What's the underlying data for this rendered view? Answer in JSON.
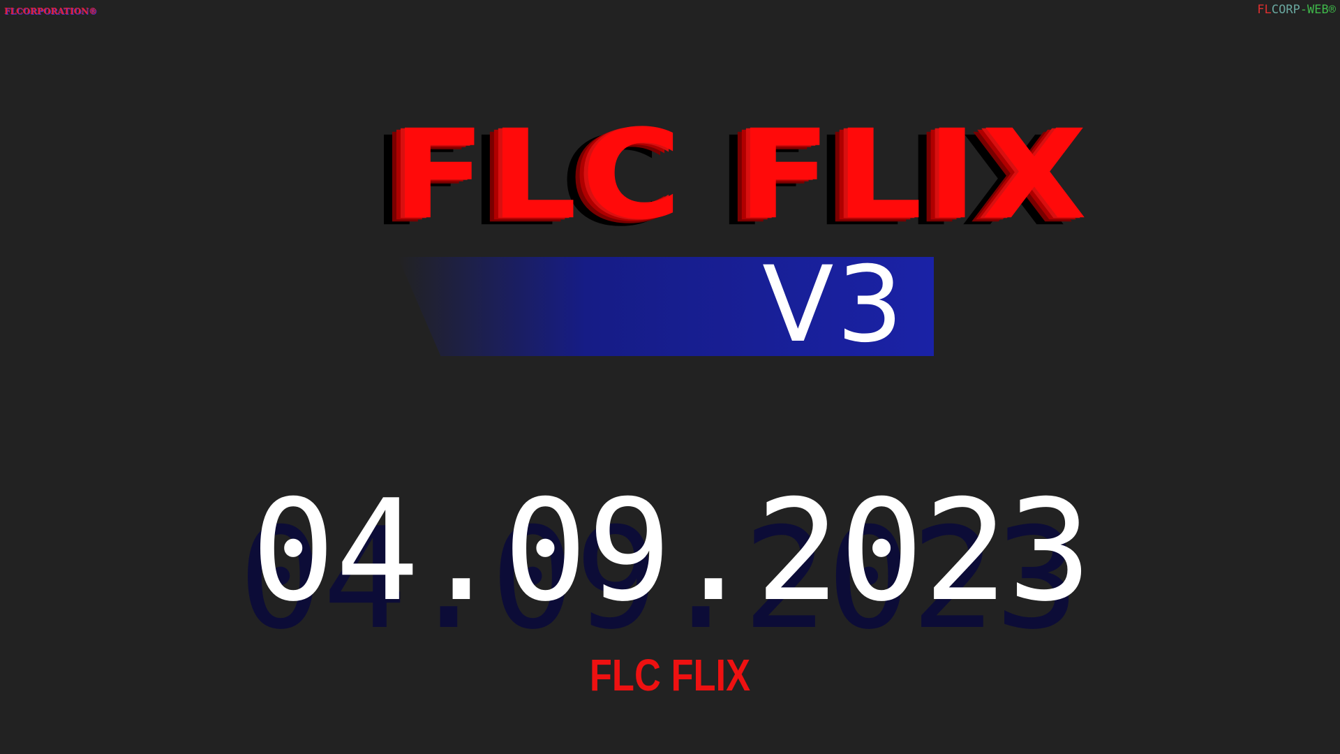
{
  "corner_left": {
    "text": "FLCORPORATION®"
  },
  "corner_right": {
    "part1": "FL",
    "part2": "CORP",
    "part3": "-WEB®"
  },
  "logo": {
    "title": "FLC FLIX",
    "version": "V3",
    "colors": {
      "title_red": "#ff0a0a",
      "bar_blue": "#1a22a6"
    }
  },
  "date": {
    "text": "04.09.2023"
  },
  "footer": {
    "title": "FLC FLIX"
  },
  "background_color": "#222222"
}
